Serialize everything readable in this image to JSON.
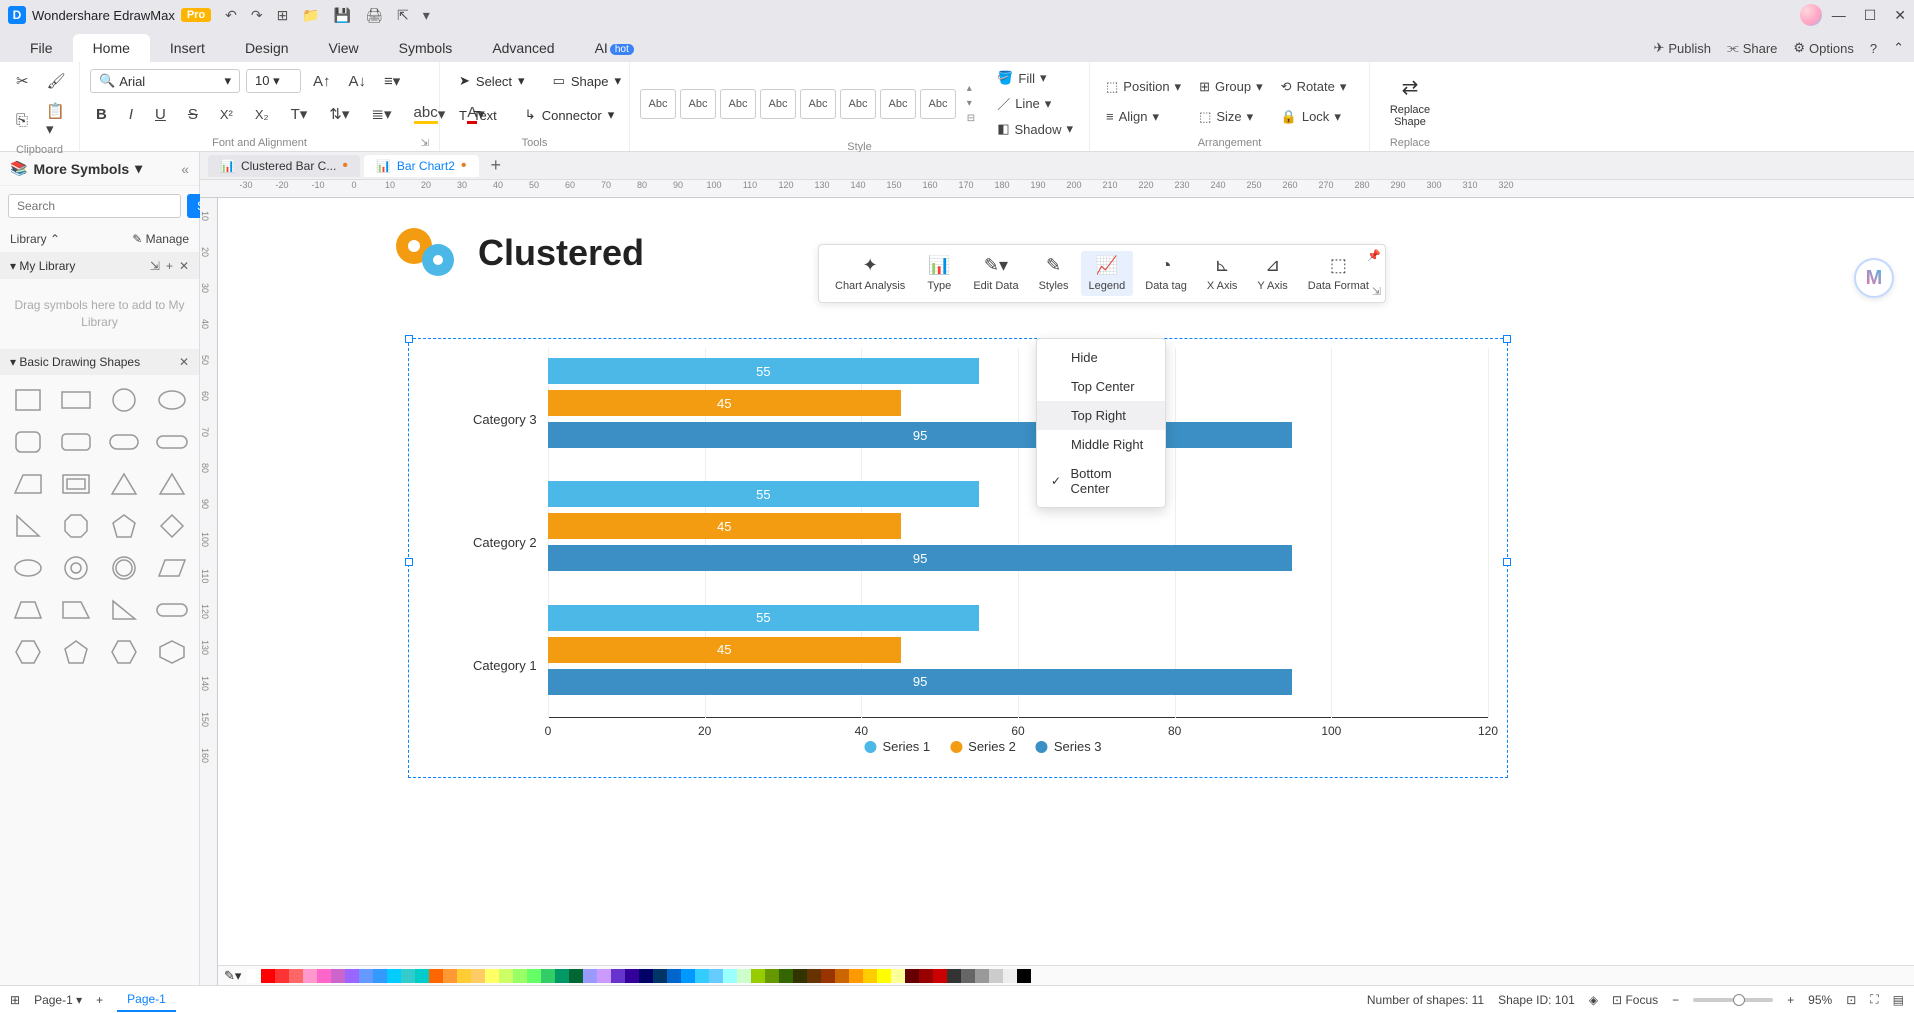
{
  "titlebar": {
    "app_name": "Wondershare EdrawMax",
    "pro": "Pro"
  },
  "menus": {
    "file": "File",
    "home": "Home",
    "insert": "Insert",
    "design": "Design",
    "view": "View",
    "symbols": "Symbols",
    "advanced": "Advanced",
    "ai": "AI",
    "ai_badge": "hot"
  },
  "right_tools": {
    "publish": "Publish",
    "share": "Share",
    "options": "Options"
  },
  "ribbon": {
    "font_name": "Arial",
    "font_size": "10",
    "select": "Select",
    "shape": "Shape",
    "text": "Text",
    "connector": "Connector",
    "swatch": "Abc",
    "fill": "Fill",
    "line": "Line",
    "shadow": "Shadow",
    "position": "Position",
    "align": "Align",
    "group": "Group",
    "size": "Size",
    "rotate": "Rotate",
    "lock": "Lock",
    "replace_shape": "Replace Shape",
    "groups": {
      "clipboard": "Clipboard",
      "font": "Font and Alignment",
      "tools": "Tools",
      "style": "Style",
      "arrangement": "Arrangement",
      "replace": "Replace"
    }
  },
  "sidebar": {
    "more_symbols": "More Symbols",
    "search_placeholder": "Search",
    "search_btn": "Search",
    "library": "Library",
    "manage": "Manage",
    "my_library": "My Library",
    "empty_hint": "Drag symbols here to add to My Library",
    "basic_shapes": "Basic Drawing Shapes"
  },
  "tabs": {
    "tab1": "Clustered Bar C...",
    "tab2": "Bar Chart2"
  },
  "chart_toolbar": {
    "chart_analysis": "Chart Analysis",
    "type": "Type",
    "edit_data": "Edit Data",
    "styles": "Styles",
    "legend": "Legend",
    "data_tag": "Data tag",
    "x_axis": "X Axis",
    "y_axis": "Y Axis",
    "data_format": "Data Format"
  },
  "legend_menu": {
    "hide": "Hide",
    "top_center": "Top Center",
    "top_right": "Top Right",
    "middle_right": "Middle Right",
    "bottom_center": "Bottom Center"
  },
  "chart": {
    "title": "Clustered"
  },
  "chart_data": {
    "type": "bar",
    "orientation": "horizontal",
    "title": "Clustered",
    "categories": [
      "Category 3",
      "Category 2",
      "Category 1"
    ],
    "series": [
      {
        "name": "Series 1",
        "color": "#4bb8e8",
        "values": [
          55,
          55,
          55
        ]
      },
      {
        "name": "Series 2",
        "color": "#f39c12",
        "values": [
          45,
          45,
          45
        ]
      },
      {
        "name": "Series 3",
        "color": "#3b8fc4",
        "values": [
          95,
          95,
          95
        ]
      }
    ],
    "x_ticks": [
      0,
      20,
      40,
      60,
      80,
      100,
      120
    ],
    "xlim": [
      0,
      120
    ],
    "legend_position": "Bottom Center"
  },
  "status": {
    "page_sel": "Page-1",
    "page_tab": "Page-1",
    "shapes": "Number of shapes: 11",
    "shape_id": "Shape ID: 101",
    "focus": "Focus",
    "zoom": "95%"
  },
  "ruler_h": [
    "-30",
    "-20",
    "-10",
    "0",
    "10",
    "20",
    "30",
    "40",
    "50",
    "60",
    "70",
    "80",
    "90",
    "100",
    "110",
    "120",
    "130",
    "140",
    "150",
    "160",
    "170",
    "180",
    "190",
    "200",
    "210",
    "220",
    "230",
    "240",
    "250",
    "260",
    "270",
    "280",
    "290",
    "300",
    "310",
    "320"
  ],
  "ruler_v": [
    "10",
    "20",
    "30",
    "40",
    "50",
    "60",
    "70",
    "80",
    "90",
    "100",
    "110",
    "120",
    "130",
    "140",
    "150",
    "160"
  ],
  "colors": [
    "#ffffff",
    "#ff0000",
    "#ff3333",
    "#ff6666",
    "#ff99cc",
    "#ff66cc",
    "#cc66cc",
    "#9966ff",
    "#6699ff",
    "#3399ff",
    "#00ccff",
    "#33cccc",
    "#00cccc",
    "#ff6600",
    "#ff9933",
    "#ffcc33",
    "#ffcc66",
    "#ffff66",
    "#ccff66",
    "#99ff66",
    "#66ff66",
    "#33cc66",
    "#009966",
    "#006633",
    "#9999ff",
    "#cc99ff",
    "#6633cc",
    "#330099",
    "#000066",
    "#003366",
    "#0066cc",
    "#0099ff",
    "#33ccff",
    "#66ccff",
    "#99ffff",
    "#ccffcc",
    "#99cc00",
    "#669900",
    "#336600",
    "#333300",
    "#663300",
    "#993300",
    "#cc6600",
    "#ff9900",
    "#ffcc00",
    "#ffff00",
    "#ffff99",
    "#660000",
    "#990000",
    "#cc0000",
    "#333333",
    "#666666",
    "#999999",
    "#cccccc",
    "#eeeeee",
    "#000000"
  ]
}
